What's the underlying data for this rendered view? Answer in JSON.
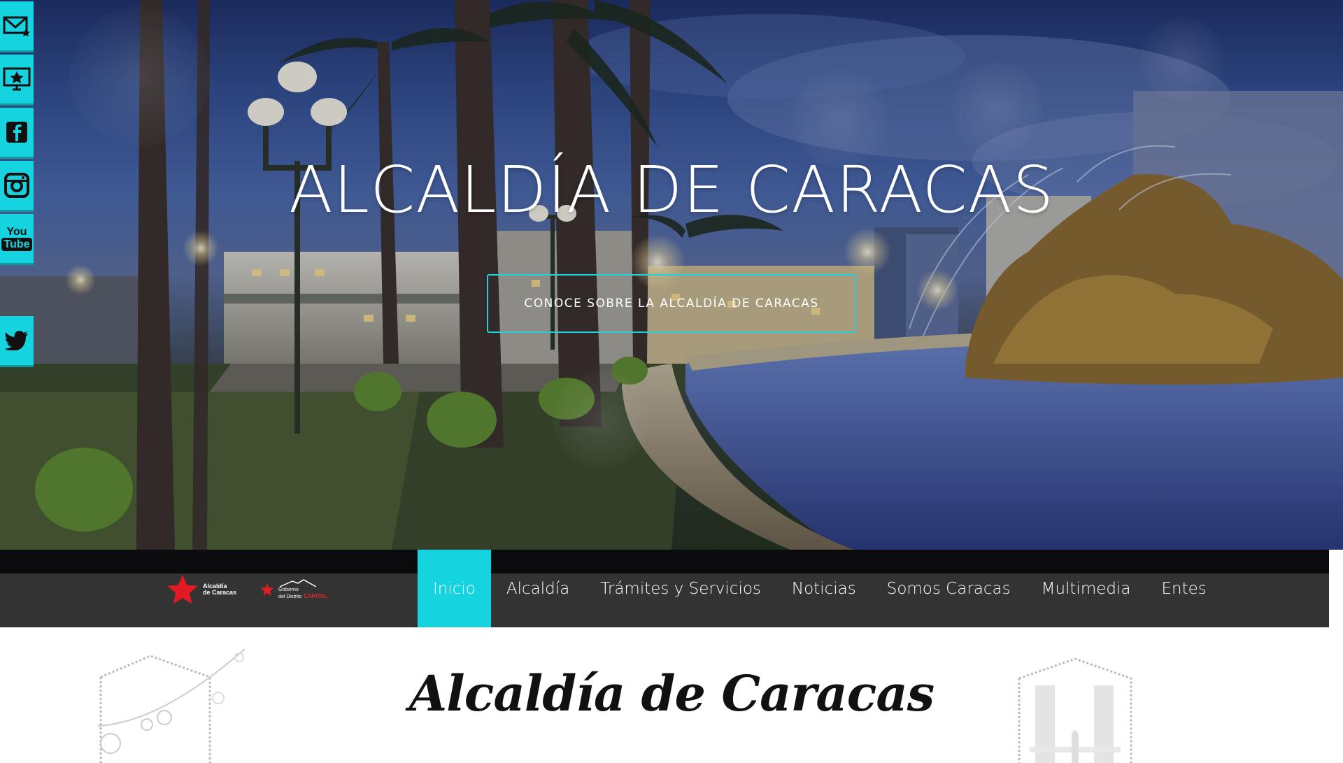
{
  "social": {
    "items": [
      {
        "name": "email",
        "icon": "envelope-star-icon"
      },
      {
        "name": "tv",
        "icon": "monitor-star-icon"
      },
      {
        "name": "facebook",
        "icon": "facebook-icon"
      },
      {
        "name": "instagram",
        "icon": "instagram-icon"
      },
      {
        "name": "youtube",
        "icon": "youtube-icon",
        "label_top": "You",
        "label_bottom": "Tube"
      },
      {
        "name": "twitter",
        "icon": "twitter-icon"
      }
    ],
    "color": "#16d4df"
  },
  "hero": {
    "title": "ALCALDÍA DE CARACAS",
    "cta_label": "CONOCE SOBRE LA ALCALDÍA DE CARACAS"
  },
  "nav": {
    "logos": {
      "alcaldia_line1": "Alcaldía",
      "alcaldia_line2": "de Caracas",
      "gobierno_line1": "Gobierno",
      "gobierno_line2": "del Distrito",
      "gobierno_line3": "CAPITAL"
    },
    "items": [
      {
        "label": "Inicio",
        "active": true
      },
      {
        "label": "Alcaldía",
        "active": false
      },
      {
        "label": "Trámites y Servicios",
        "active": false
      },
      {
        "label": "Noticias",
        "active": false
      },
      {
        "label": "Somos Caracas",
        "active": false
      },
      {
        "label": "Multimedia",
        "active": false
      },
      {
        "label": "Entes",
        "active": false
      }
    ],
    "active_color": "#16d4df",
    "bar_color": "#333333"
  },
  "content": {
    "title": "Alcaldía de Caracas"
  }
}
